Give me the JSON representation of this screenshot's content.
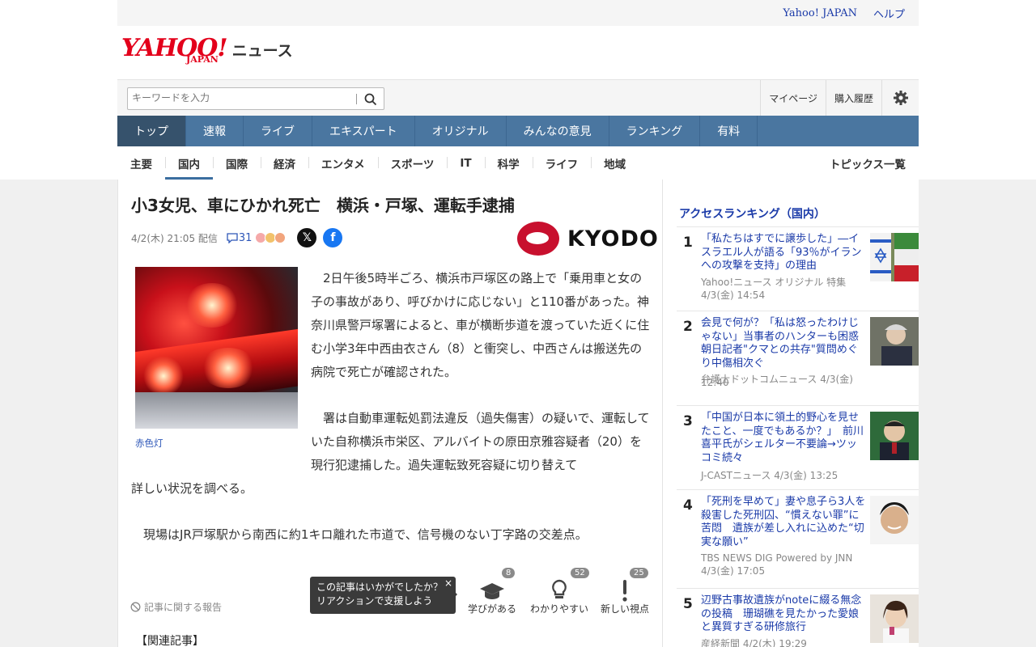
{
  "util": {
    "yahoo_japan": "Yahoo! JAPAN",
    "help": "ヘルプ"
  },
  "logo": {
    "yahoo": "YAHOO!",
    "japan": "JAPAN",
    "news": "ニュース"
  },
  "search": {
    "placeholder": "キーワードを入力"
  },
  "account": {
    "mypage": "マイページ",
    "history": "購入履歴"
  },
  "mainnav": [
    "トップ",
    "速報",
    "ライブ",
    "エキスパート",
    "オリジナル",
    "みんなの意見",
    "ランキング",
    "有料"
  ],
  "subnav": [
    "主要",
    "国内",
    "国際",
    "経済",
    "エンタメ",
    "スポーツ",
    "IT",
    "科学",
    "ライフ",
    "地域"
  ],
  "topics_all": "トピックス一覧",
  "article": {
    "title": "小3女児、車にひかれ死亡　横浜・戸塚、運転手逮捕",
    "date": "4/2(木) 21:05 配信",
    "comments": "31",
    "source_logo": "KYODO",
    "photo_caption": "赤色灯",
    "p1": "2日午後5時半ごろ、横浜市戸塚区の路上で「乗用車と女の子の事故があり、呼びかけに応じない」と110番があった。神奈川県警戸塚署によると、車が横断歩道を渡っていた近くに住む小学3年中西由衣さん（8）と衝突し、中西さんは搬送先の病院で死亡が確認された。",
    "p2": "署は自動車運転処罰法違反（過失傷害）の疑いで、運転していた自称横浜市栄区、アルバイトの原田京雅容疑者（20）を現行犯逮捕した。過失運転致死容疑に切り替えて",
    "p2b": "詳しい状況を調べる。",
    "p3": "現場はJR戸塚駅から南西に約1キロ離れた市道で、信号機のない丁字路の交差点。",
    "report": "記事に関する報告",
    "popup_line1": "この記事はいかがでしたか？",
    "popup_line2": "リアクションで支援しよう",
    "popup_close": "×",
    "reactions": [
      {
        "label": "学びがある",
        "count": "8"
      },
      {
        "label": "わかりやすい",
        "count": "52"
      },
      {
        "label": "新しい視点",
        "count": "25"
      }
    ],
    "related": "【関連記事】"
  },
  "sidebar": {
    "heading": "アクセスランキング（国内）",
    "items": [
      {
        "num": "1",
        "title": "「私たちはすでに譲歩した」―イスラエル人が語る「93％がイランへの攻撃を支持」の理由",
        "source": "Yahoo!ニュース オリジナル 特集",
        "time": "4/3(金) 14:54"
      },
      {
        "num": "2",
        "title": "会見で何が？「私は怒ったわけじゃない」当事者のハンターも困惑 朝日記者\"クマとの共存\"質問めぐり中傷相次ぐ",
        "source": "弁護士ドットコムニュース 4/3(金)",
        "time": "12:40"
      },
      {
        "num": "3",
        "title": "「中国が日本に領土的野心を見せたこと、一度でもあるか？」　前川喜平氏がシェルター不要論→ツッコミ続々",
        "source": "J-CASTニュース 4/3(金) 13:25",
        "time": ""
      },
      {
        "num": "4",
        "title": "「死刑を早めて」妻や息子ら3人を殺害した死刑囚、“慣えない罪”に苦悶　遺族が差し入れに込めた“切実な願い”",
        "source": "TBS NEWS DIG Powered by JNN",
        "time": "4/3(金) 17:05"
      },
      {
        "num": "5",
        "title": "辺野古事故遺族がnoteに綴る無念の投稿　珊瑚礁を見たかった愛娘と異質すぎる研修旅行",
        "source": "産経新聞 4/2(木) 19:29",
        "time": ""
      }
    ]
  },
  "colors": {
    "brand_red": "#e3001b",
    "nav_blue": "#4a76a0",
    "link_blue": "#1a3aa8"
  }
}
